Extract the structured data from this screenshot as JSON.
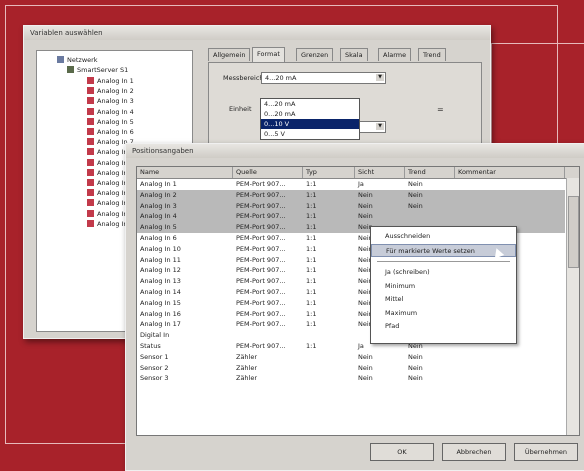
{
  "back_window": {
    "title": "Variablen auswählen",
    "tree": {
      "root": "Netzwerk",
      "device": "SmartServer S1",
      "items": [
        "Analog In 1",
        "Analog In 2",
        "Analog In 3",
        "Analog In 4",
        "Analog In 5",
        "Analog In 6",
        "Analog In 7",
        "Analog In 8",
        "Analog In 9",
        "Analog In 10",
        "Analog In 11",
        "Analog In 12",
        "Analog In 13",
        "Analog In 14",
        "Analog In 15"
      ]
    },
    "tabs": [
      "Allgemein",
      "Format",
      "Grenzen",
      "Skala",
      "Alarme",
      "Trend"
    ],
    "panel": {
      "label_1": "Messbereich",
      "select_value": "4...20 mA",
      "label_2": "Einheit",
      "dropdown_options": [
        "4...20 mA",
        "0...20 mA",
        "0...10 V",
        "0...5 V"
      ],
      "dropdown_selected": 2,
      "equals": "="
    }
  },
  "front_window": {
    "title": "Positionsangaben",
    "columns": [
      "Name",
      "Quelle",
      "Typ",
      "Sicht",
      "Trend",
      "Kommentar"
    ],
    "rows": [
      {
        "name": "Analog In 1",
        "source": "PEM-Port 907...",
        "type": "1:1",
        "view": "Ja",
        "trend": "Nein",
        "selected": false
      },
      {
        "name": "Analog In 2",
        "source": "PEM-Port 907...",
        "type": "1:1",
        "view": "Nein",
        "trend": "Nein",
        "selected": true
      },
      {
        "name": "Analog In 3",
        "source": "PEM-Port 907...",
        "type": "1:1",
        "view": "Nein",
        "trend": "Nein",
        "selected": true
      },
      {
        "name": "Analog In 4",
        "source": "PEM-Port 907...",
        "type": "1:1",
        "view": "Nein",
        "trend": "",
        "selected": true
      },
      {
        "name": "Analog In 5",
        "source": "PEM-Port 907...",
        "type": "1:1",
        "view": "Nein",
        "trend": "",
        "selected": true
      },
      {
        "name": "Analog In 6",
        "source": "PEM-Port 907...",
        "type": "1:1",
        "view": "Nein",
        "trend": "",
        "selected": false
      },
      {
        "name": "Analog In 10",
        "source": "PEM-Port 907...",
        "type": "1:1",
        "view": "Nein",
        "trend": "",
        "selected": false
      },
      {
        "name": "Analog In 11",
        "source": "PEM-Port 907...",
        "type": "1:1",
        "view": "Nein",
        "trend": "",
        "selected": false
      },
      {
        "name": "Analog In 12",
        "source": "PEM-Port 907...",
        "type": "1:1",
        "view": "Nein",
        "trend": "",
        "selected": false
      },
      {
        "name": "Analog In 13",
        "source": "PEM-Port 907...",
        "type": "1:1",
        "view": "Nein",
        "trend": "",
        "selected": false
      },
      {
        "name": "Analog In 14",
        "source": "PEM-Port 907...",
        "type": "1:1",
        "view": "Nein",
        "trend": "",
        "selected": false
      },
      {
        "name": "Analog In 15",
        "source": "PEM-Port 907...",
        "type": "1:1",
        "view": "Nein",
        "trend": "",
        "selected": false
      },
      {
        "name": "Analog In 16",
        "source": "PEM-Port 907...",
        "type": "1:1",
        "view": "Nein",
        "trend": "Nein",
        "selected": false
      },
      {
        "name": "Analog In 17",
        "source": "PEM-Port 907...",
        "type": "1:1",
        "view": "Nein",
        "trend": "Nein",
        "selected": false
      },
      {
        "name": "Digital In",
        "source": "",
        "type": "",
        "view": "",
        "trend": "",
        "selected": false
      },
      {
        "name": "Status",
        "source": "PEM-Port 907...",
        "type": "1:1",
        "view": "Ja",
        "trend": "Nein",
        "selected": false
      },
      {
        "name": "Sensor 1",
        "source": "Zähler",
        "type": "",
        "view": "Nein",
        "trend": "Nein",
        "selected": false
      },
      {
        "name": "Sensor 2",
        "source": "Zähler",
        "type": "",
        "view": "Nein",
        "trend": "Nein",
        "selected": false
      },
      {
        "name": "Sensor 3",
        "source": "Zähler",
        "type": "",
        "view": "Nein",
        "trend": "Nein",
        "selected": false
      }
    ],
    "context_menu": [
      "Ausschneiden",
      "Für markierte Werte setzen",
      "",
      "Ja (schreiben)",
      "Minimum",
      "Mittel",
      "Maximum",
      "Pfad"
    ],
    "context_highlight": 1,
    "buttons": {
      "ok": "OK",
      "cancel": "Abbrechen",
      "apply": "Übernehmen"
    }
  }
}
